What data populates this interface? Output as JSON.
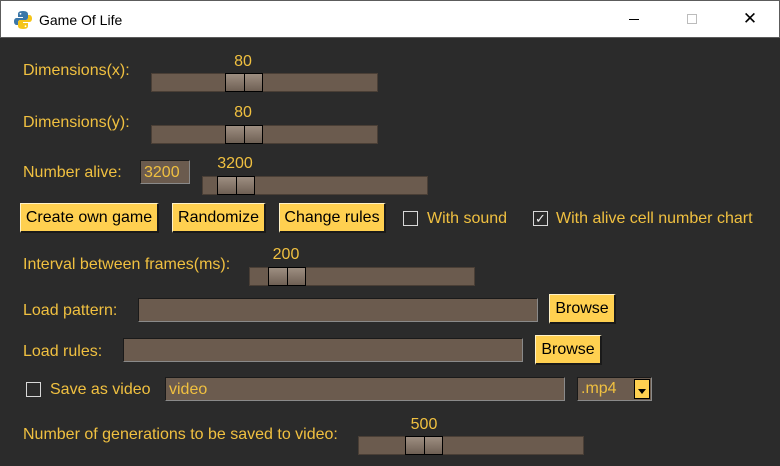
{
  "window": {
    "title": "Game Of Life",
    "close_glyph": "✕"
  },
  "dim_x": {
    "label": "Dimensions(x):",
    "value": "80"
  },
  "dim_y": {
    "label": "Dimensions(y):",
    "value": "80"
  },
  "alive": {
    "label": "Number alive:",
    "entry_value": "3200",
    "slider_value": "3200"
  },
  "buttons": {
    "create": "Create own game",
    "randomize": "Randomize",
    "change_rules": "Change rules"
  },
  "options": {
    "sound": {
      "label": "With sound",
      "checked": false
    },
    "chart": {
      "label": "With alive cell number chart",
      "checked": true,
      "check_glyph": "✓"
    }
  },
  "interval": {
    "label": "Interval between frames(ms):",
    "value": "200"
  },
  "load_pattern": {
    "label": "Load pattern:",
    "value": "",
    "browse": "Browse"
  },
  "load_rules": {
    "label": "Load rules:",
    "value": "",
    "browse": "Browse"
  },
  "video": {
    "checkbox_label": "Save as video",
    "checked": false,
    "filename": "video",
    "format": ".mp4"
  },
  "generations": {
    "label": "Number of generations to be saved to video:",
    "value": "500"
  },
  "colors": {
    "background": "#2b2b2b",
    "accent_text": "#f0c040",
    "button": "#ffd050",
    "trough": "#6b5b4e"
  },
  "icons": {
    "app": "python-icon",
    "minimize": "minimize-icon",
    "maximize": "maximize-icon",
    "close": "close-icon"
  }
}
